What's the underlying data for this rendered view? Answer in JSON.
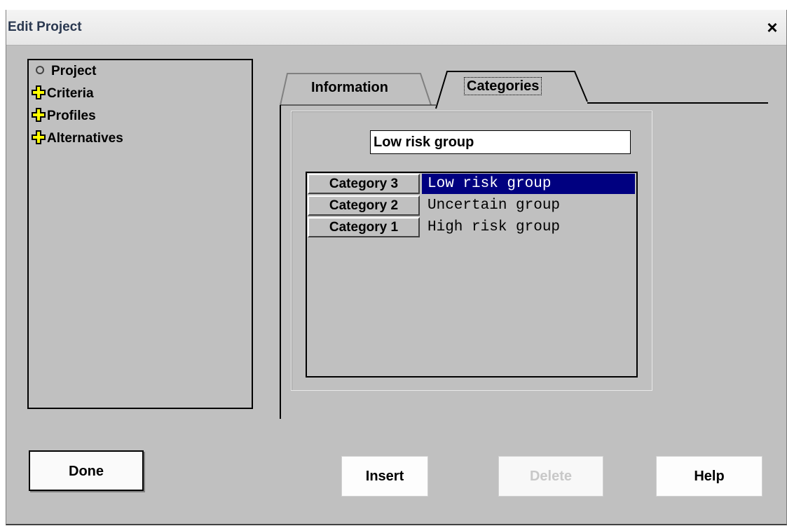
{
  "window": {
    "title": "Edit Project",
    "close_label": "×"
  },
  "tree": {
    "items": [
      {
        "label": "Project",
        "icon": "bullet-icon"
      },
      {
        "label": "Criteria",
        "icon": "plus-icon"
      },
      {
        "label": "Profiles",
        "icon": "plus-icon"
      },
      {
        "label": "Alternatives",
        "icon": "plus-icon"
      }
    ]
  },
  "tabs": {
    "information": "Information",
    "categories": "Categories",
    "active": "Categories"
  },
  "categories": {
    "name_input_value": "Low risk group",
    "rows": [
      {
        "header": "Category 3",
        "value": "Low risk group",
        "selected": true
      },
      {
        "header": "Category 2",
        "value": "Uncertain group",
        "selected": false
      },
      {
        "header": "Category 1",
        "value": "High risk group",
        "selected": false
      }
    ]
  },
  "buttons": {
    "done": "Done",
    "insert": "Insert",
    "delete": "Delete",
    "help": "Help"
  },
  "colors": {
    "selection": "#000080",
    "dialog_bg": "#c0c0c0",
    "plus_icon": "#ffff00"
  }
}
